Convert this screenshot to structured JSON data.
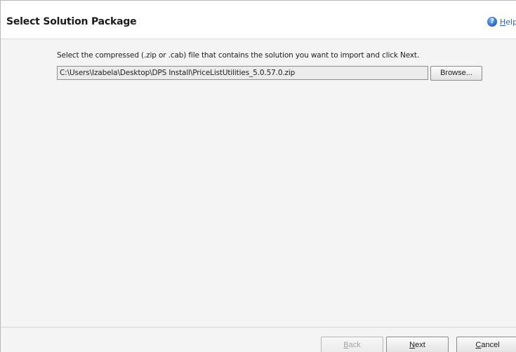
{
  "dialog": {
    "title": "Select Solution Package",
    "help": {
      "icon": "help-icon",
      "accesskey": "H",
      "label_rest": "elp"
    }
  },
  "content": {
    "instruction": "Select the compressed (.zip or .cab) file that contains the solution you want to import and click Next.",
    "file_path": "C:\\Users\\Izabela\\Desktop\\DPS Install\\PriceListUtilities_5.0.57.0.zip",
    "browse_label": "Browse..."
  },
  "footer": {
    "back": {
      "accesskey": "B",
      "label_rest": "ack",
      "enabled": false
    },
    "next": {
      "accesskey": "N",
      "label_rest": "ext",
      "enabled": true
    },
    "cancel": {
      "accesskey": "C",
      "label_rest": "ancel",
      "enabled": true
    }
  }
}
